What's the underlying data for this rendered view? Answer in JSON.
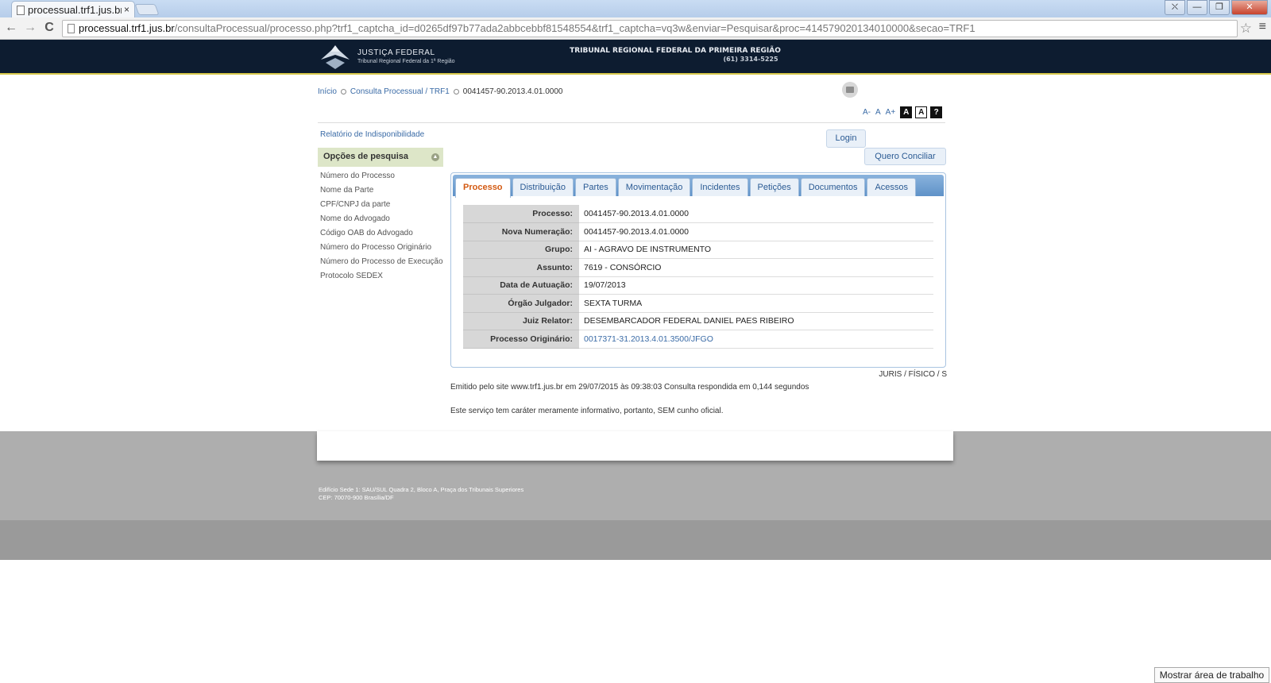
{
  "browser": {
    "tab_title": "processual.trf1.jus.br",
    "tab_close": "×",
    "url_host": "processual.trf1.jus.br",
    "url_path": "/consultaProcessual/processo.php?trf1_captcha_id=d0265df97b77ada2abbcebbf81548554&trf1_captcha=vq3w&enviar=Pesquisar&proc=414579020134010000&secao=TRF1",
    "back_icon": "←",
    "forward_icon": "→",
    "reload_icon": "C",
    "star_icon": "☆",
    "menu_icon": "≡",
    "window_buttons": [
      "⛌",
      "—",
      "❐",
      "✕"
    ]
  },
  "header": {
    "logo_title": "JUSTIÇA FEDERAL",
    "logo_subtitle": "Tribunal Regional Federal da 1ª Região",
    "court_name": "TRIBUNAL REGIONAL FEDERAL DA PRIMEIRA REGIÃO",
    "court_phone": "(61) 3314-5225"
  },
  "breadcrumb": {
    "home": "Início",
    "section": "Consulta Processual / TRF1",
    "current": "0041457-90.2013.4.01.0000"
  },
  "font_controls": {
    "decrease": "A-",
    "normal": "A",
    "increase": "A+",
    "contrast_dark": "A",
    "contrast_light": "A",
    "help": "?"
  },
  "sidebar": {
    "report_link": "Relatório de Indisponibilidade",
    "options_header": "Opções de pesquisa",
    "items": [
      "Número do Processo",
      "Nome da Parte",
      "CPF/CNPJ da parte",
      "Nome do Advogado",
      "Código OAB do Advogado",
      "Número do Processo Originário",
      "Número do Processo de Execução",
      "Protocolo SEDEX"
    ]
  },
  "buttons": {
    "login": "Login",
    "conciliar": "Quero Conciliar"
  },
  "tabs": [
    "Processo",
    "Distribuição",
    "Partes",
    "Movimentação",
    "Incidentes",
    "Petições",
    "Documentos",
    "Acessos"
  ],
  "process": [
    {
      "label": "Processo:",
      "value": "0041457-90.2013.4.01.0000"
    },
    {
      "label": "Nova Numeração:",
      "value": "0041457-90.2013.4.01.0000"
    },
    {
      "label": "Grupo:",
      "value": "AI - AGRAVO DE INSTRUMENTO"
    },
    {
      "label": "Assunto:",
      "value": "7619 - CONSÓRCIO"
    },
    {
      "label": "Data de Autuação:",
      "value": "19/07/2013"
    },
    {
      "label": "Órgão Julgador:",
      "value": "SEXTA TURMA"
    },
    {
      "label": "Juiz Relator:",
      "value": "DESEMBARCADOR FEDERAL DANIEL PAES RIBEIRO"
    },
    {
      "label": "Processo Originário:",
      "value": "0017371-31.2013.4.01.3500/JFGO"
    }
  ],
  "classification": "JURIS / FÍSICO / S",
  "emitted": "Emitido pelo site www.trf1.jus.br em 29/07/2015 às 09:38:03 Consulta respondida em 0,144 segundos",
  "disclaimer": "Este serviço tem caráter meramente informativo, portanto, SEM cunho oficial.",
  "footer": {
    "address_line1": "Edifício Sede 1: SAU/SUL Quadra 2, Bloco A, Praça dos Tribunais Superiores",
    "address_line2": "CEP: 70070-900 Brasília/DF"
  },
  "taskbar": {
    "show_desktop": "Mostrar área de trabalho"
  }
}
